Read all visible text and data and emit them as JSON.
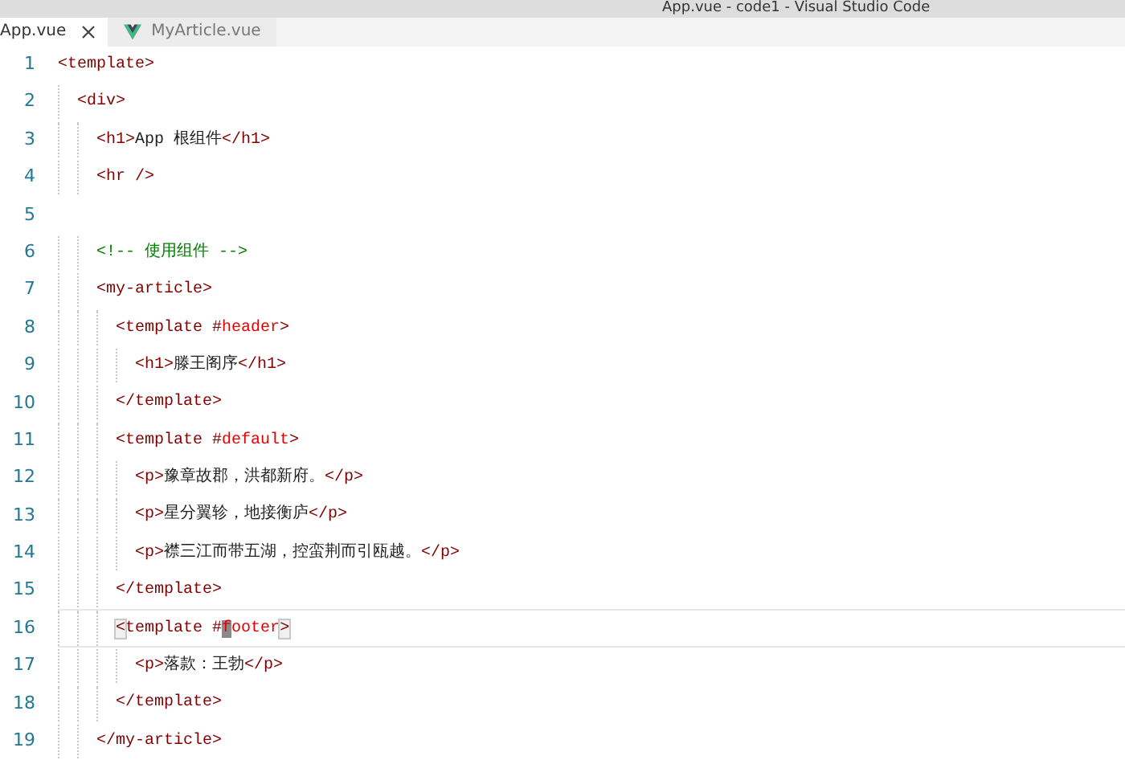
{
  "window": {
    "title": "App.vue - code1 - Visual Studio Code"
  },
  "tabs": [
    {
      "label": "App.vue",
      "selected": true,
      "closable": true,
      "vue_icon": false
    },
    {
      "label": "MyArticle.vue",
      "selected": false,
      "closable": false,
      "vue_icon": true
    }
  ],
  "editor": {
    "lines": [
      {
        "number": "1",
        "current": false,
        "tokens": [
          {
            "kind": "tag",
            "text": "<template>"
          }
        ],
        "children": [
          {
            "number": "2",
            "current": false,
            "tokens": [
              {
                "kind": "tag",
                "text": "<div>"
              }
            ],
            "children": [
              {
                "number": "3",
                "current": false,
                "tokens": [
                  {
                    "kind": "tag",
                    "text": "<h1>"
                  },
                  {
                    "kind": "text",
                    "text": "App 根组件"
                  },
                  {
                    "kind": "tag",
                    "text": "</h1>"
                  }
                ]
              },
              {
                "number": "4",
                "current": false,
                "tokens": [
                  {
                    "kind": "tag",
                    "text": "<hr />"
                  }
                ]
              },
              {
                "number": "5",
                "current": false
              },
              {
                "number": "6",
                "current": false,
                "tokens": [
                  {
                    "kind": "comment",
                    "text": "<!-- 使用组件 -->"
                  }
                ]
              },
              {
                "number": "7",
                "current": false,
                "tokens": [
                  {
                    "kind": "tag",
                    "text": "<my-article>"
                  }
                ],
                "children": [
                  {
                    "number": "8",
                    "current": false,
                    "tokens": [
                      {
                        "kind": "tag",
                        "text": "<template #"
                      },
                      {
                        "kind": "attr",
                        "text": "header"
                      },
                      {
                        "kind": "tag",
                        "text": ">"
                      }
                    ],
                    "children": [
                      {
                        "number": "9",
                        "current": false,
                        "tokens": [
                          {
                            "kind": "tag",
                            "text": "<h1>"
                          },
                          {
                            "kind": "text",
                            "text": "滕王阁序"
                          },
                          {
                            "kind": "tag",
                            "text": "</h1>"
                          }
                        ]
                      }
                    ]
                  },
                  {
                    "number": "10",
                    "current": false,
                    "tokens": [
                      {
                        "kind": "tag",
                        "text": "</template>"
                      }
                    ]
                  },
                  {
                    "number": "11",
                    "current": false,
                    "tokens": [
                      {
                        "kind": "tag",
                        "text": "<template #"
                      },
                      {
                        "kind": "attr",
                        "text": "default"
                      },
                      {
                        "kind": "tag",
                        "text": ">"
                      }
                    ],
                    "children": [
                      {
                        "number": "12",
                        "current": false,
                        "tokens": [
                          {
                            "kind": "tag",
                            "text": "<p>"
                          },
                          {
                            "kind": "text",
                            "text": "豫章故郡，洪都新府。"
                          },
                          {
                            "kind": "tag",
                            "text": "</p>"
                          }
                        ]
                      },
                      {
                        "number": "13",
                        "current": false,
                        "tokens": [
                          {
                            "kind": "tag",
                            "text": "<p>"
                          },
                          {
                            "kind": "text",
                            "text": "星分翼轸，地接衡庐"
                          },
                          {
                            "kind": "tag",
                            "text": "</p>"
                          }
                        ]
                      },
                      {
                        "number": "14",
                        "current": false,
                        "tokens": [
                          {
                            "kind": "tag",
                            "text": "<p>"
                          },
                          {
                            "kind": "text",
                            "text": "襟三江而带五湖，控蛮荆而引瓯越。"
                          },
                          {
                            "kind": "tag",
                            "text": "</p>"
                          }
                        ]
                      }
                    ]
                  },
                  {
                    "number": "15",
                    "current": false,
                    "tokens": [
                      {
                        "kind": "tag",
                        "text": "</template>"
                      }
                    ]
                  },
                  {
                    "number": "16",
                    "current": true,
                    "tokens": [
                      {
                        "kind": "bracket",
                        "text": "<"
                      },
                      {
                        "kind": "tag",
                        "text": "template #"
                      },
                      {
                        "kind": "cursor",
                        "text": "f"
                      },
                      {
                        "kind": "attr",
                        "text": "ooter"
                      },
                      {
                        "kind": "bracket",
                        "text": ">"
                      }
                    ],
                    "children": [
                      {
                        "number": "17",
                        "current": false,
                        "tokens": [
                          {
                            "kind": "tag",
                            "text": "<p>"
                          },
                          {
                            "kind": "text",
                            "text": "落款：王勃"
                          },
                          {
                            "kind": "tag",
                            "text": "</p>"
                          }
                        ]
                      }
                    ]
                  },
                  {
                    "number": "18",
                    "current": false,
                    "tokens": [
                      {
                        "kind": "tag",
                        "text": "</template>"
                      }
                    ]
                  }
                ]
              },
              {
                "number": "19",
                "current": false,
                "tokens": [
                  {
                    "kind": "tag",
                    "text": "</my-article>"
                  }
                ]
              }
            ]
          }
        ]
      }
    ]
  }
}
